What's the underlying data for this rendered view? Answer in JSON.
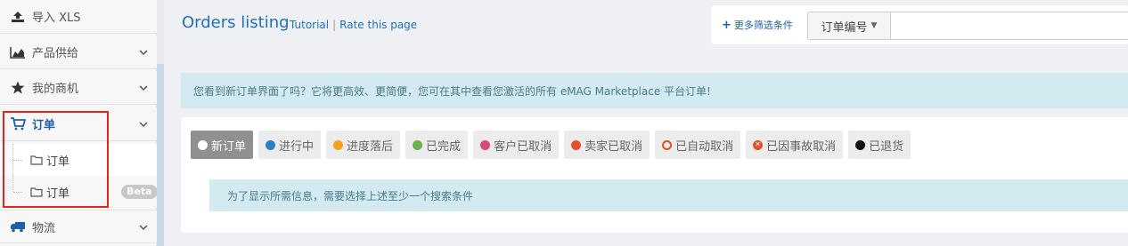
{
  "sidebar": {
    "items": [
      {
        "label": "导入 XLS",
        "icon": "upload-icon"
      },
      {
        "label": "产品供给",
        "icon": "area-chart-icon"
      },
      {
        "label": "我的商机",
        "icon": "star-icon"
      },
      {
        "label": "订单",
        "icon": "cart-icon"
      },
      {
        "label": "物流",
        "icon": "truck-icon"
      }
    ],
    "sub_items": [
      {
        "label": "订单",
        "icon": "folder-icon"
      },
      {
        "label": "订单",
        "icon": "folder-icon",
        "badge": "Beta"
      }
    ]
  },
  "header": {
    "title": "Orders listing",
    "tutorial": "Tutorial",
    "separator": "|",
    "rate": "Rate this page"
  },
  "filters": {
    "more_filters": "更多筛选条件",
    "order_number_select": "订单编号",
    "search_value": ""
  },
  "banner": {
    "info": "您看到新订单界面了吗？它将更高效、更简便，您可在其中查看您激活的所有 eMAG Marketplace 平台订单!"
  },
  "statuses": [
    {
      "label": "新订单",
      "color": "#ffffff",
      "active": true
    },
    {
      "label": "进行中",
      "color": "#2a7fc9"
    },
    {
      "label": "进度落后",
      "color": "#f5a21c"
    },
    {
      "label": "已完成",
      "color": "#6ab04c"
    },
    {
      "label": "客户已取消",
      "color": "#d94a7a"
    },
    {
      "label": "卖家已取消",
      "color": "#e0502a"
    },
    {
      "label": "已自动取消",
      "color": "#e0502a"
    },
    {
      "label": "已因事故取消",
      "color": "#e0502a"
    },
    {
      "label": "已退货",
      "color": "#111111"
    }
  ],
  "hint": "为了显示所需信息，需要选择上述至少一个搜索条件"
}
